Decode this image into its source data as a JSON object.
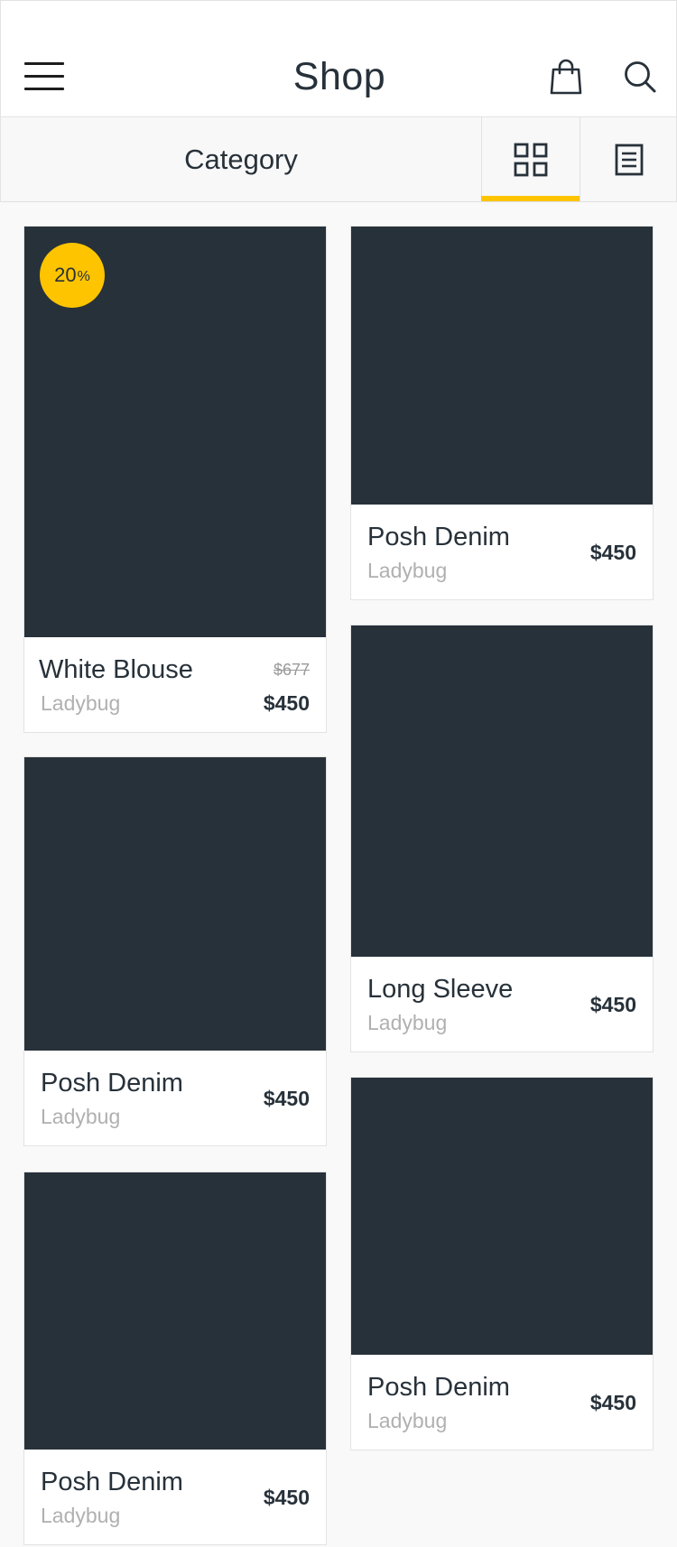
{
  "header": {
    "title": "Shop",
    "menu_icon": "hamburger-menu-icon",
    "bag_icon": "shopping-bag-icon",
    "search_icon": "search-icon"
  },
  "category_bar": {
    "label": "Category",
    "grid_icon": "grid-view-icon",
    "list_icon": "list-view-icon",
    "active_view": "grid",
    "accent_color": "#ffc400"
  },
  "products": [
    {
      "name": "White Blouse",
      "brand": "Ladybug",
      "price": "$450",
      "old_price": "$677",
      "badge_value": "20",
      "badge_unit": "%"
    },
    {
      "name": "Posh Denim",
      "brand": "Ladybug",
      "price": "$450"
    },
    {
      "name": "Posh Denim",
      "brand": "Ladybug",
      "price": "$450"
    },
    {
      "name": "Long Sleeve",
      "brand": "Ladybug",
      "price": "$450"
    },
    {
      "name": "Posh Denim",
      "brand": "Ladybug",
      "price": "$450"
    },
    {
      "name": "Posh Denim",
      "brand": "Ladybug",
      "price": "$450"
    }
  ],
  "colors": {
    "image_placeholder": "#27313a",
    "badge": "#ffc400",
    "text": "#27313a",
    "muted": "#b0b0b0"
  }
}
